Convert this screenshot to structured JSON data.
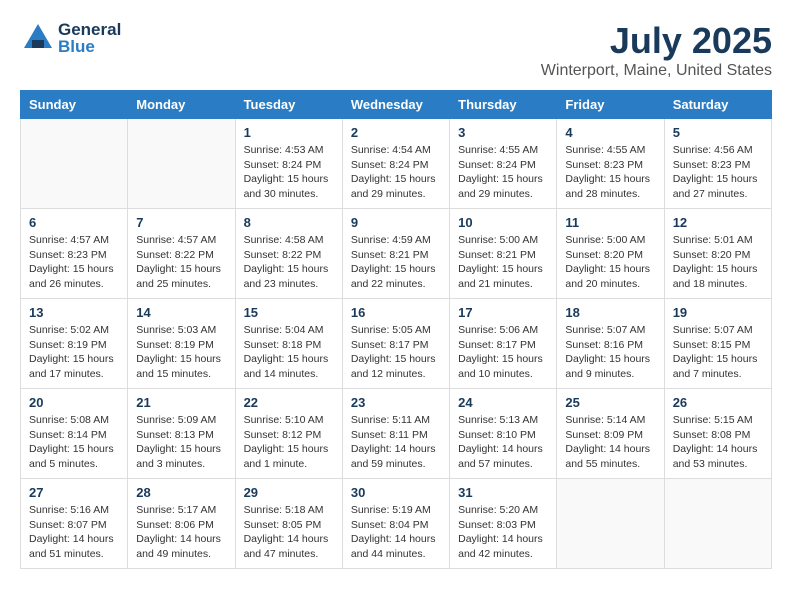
{
  "header": {
    "logo_general": "General",
    "logo_blue": "Blue",
    "month_year": "July 2025",
    "location": "Winterport, Maine, United States"
  },
  "weekdays": [
    "Sunday",
    "Monday",
    "Tuesday",
    "Wednesday",
    "Thursday",
    "Friday",
    "Saturday"
  ],
  "weeks": [
    [
      {
        "day": "",
        "info": ""
      },
      {
        "day": "",
        "info": ""
      },
      {
        "day": "1",
        "info": "Sunrise: 4:53 AM\nSunset: 8:24 PM\nDaylight: 15 hours\nand 30 minutes."
      },
      {
        "day": "2",
        "info": "Sunrise: 4:54 AM\nSunset: 8:24 PM\nDaylight: 15 hours\nand 29 minutes."
      },
      {
        "day": "3",
        "info": "Sunrise: 4:55 AM\nSunset: 8:24 PM\nDaylight: 15 hours\nand 29 minutes."
      },
      {
        "day": "4",
        "info": "Sunrise: 4:55 AM\nSunset: 8:23 PM\nDaylight: 15 hours\nand 28 minutes."
      },
      {
        "day": "5",
        "info": "Sunrise: 4:56 AM\nSunset: 8:23 PM\nDaylight: 15 hours\nand 27 minutes."
      }
    ],
    [
      {
        "day": "6",
        "info": "Sunrise: 4:57 AM\nSunset: 8:23 PM\nDaylight: 15 hours\nand 26 minutes."
      },
      {
        "day": "7",
        "info": "Sunrise: 4:57 AM\nSunset: 8:22 PM\nDaylight: 15 hours\nand 25 minutes."
      },
      {
        "day": "8",
        "info": "Sunrise: 4:58 AM\nSunset: 8:22 PM\nDaylight: 15 hours\nand 23 minutes."
      },
      {
        "day": "9",
        "info": "Sunrise: 4:59 AM\nSunset: 8:21 PM\nDaylight: 15 hours\nand 22 minutes."
      },
      {
        "day": "10",
        "info": "Sunrise: 5:00 AM\nSunset: 8:21 PM\nDaylight: 15 hours\nand 21 minutes."
      },
      {
        "day": "11",
        "info": "Sunrise: 5:00 AM\nSunset: 8:20 PM\nDaylight: 15 hours\nand 20 minutes."
      },
      {
        "day": "12",
        "info": "Sunrise: 5:01 AM\nSunset: 8:20 PM\nDaylight: 15 hours\nand 18 minutes."
      }
    ],
    [
      {
        "day": "13",
        "info": "Sunrise: 5:02 AM\nSunset: 8:19 PM\nDaylight: 15 hours\nand 17 minutes."
      },
      {
        "day": "14",
        "info": "Sunrise: 5:03 AM\nSunset: 8:19 PM\nDaylight: 15 hours\nand 15 minutes."
      },
      {
        "day": "15",
        "info": "Sunrise: 5:04 AM\nSunset: 8:18 PM\nDaylight: 15 hours\nand 14 minutes."
      },
      {
        "day": "16",
        "info": "Sunrise: 5:05 AM\nSunset: 8:17 PM\nDaylight: 15 hours\nand 12 minutes."
      },
      {
        "day": "17",
        "info": "Sunrise: 5:06 AM\nSunset: 8:17 PM\nDaylight: 15 hours\nand 10 minutes."
      },
      {
        "day": "18",
        "info": "Sunrise: 5:07 AM\nSunset: 8:16 PM\nDaylight: 15 hours\nand 9 minutes."
      },
      {
        "day": "19",
        "info": "Sunrise: 5:07 AM\nSunset: 8:15 PM\nDaylight: 15 hours\nand 7 minutes."
      }
    ],
    [
      {
        "day": "20",
        "info": "Sunrise: 5:08 AM\nSunset: 8:14 PM\nDaylight: 15 hours\nand 5 minutes."
      },
      {
        "day": "21",
        "info": "Sunrise: 5:09 AM\nSunset: 8:13 PM\nDaylight: 15 hours\nand 3 minutes."
      },
      {
        "day": "22",
        "info": "Sunrise: 5:10 AM\nSunset: 8:12 PM\nDaylight: 15 hours\nand 1 minute."
      },
      {
        "day": "23",
        "info": "Sunrise: 5:11 AM\nSunset: 8:11 PM\nDaylight: 14 hours\nand 59 minutes."
      },
      {
        "day": "24",
        "info": "Sunrise: 5:13 AM\nSunset: 8:10 PM\nDaylight: 14 hours\nand 57 minutes."
      },
      {
        "day": "25",
        "info": "Sunrise: 5:14 AM\nSunset: 8:09 PM\nDaylight: 14 hours\nand 55 minutes."
      },
      {
        "day": "26",
        "info": "Sunrise: 5:15 AM\nSunset: 8:08 PM\nDaylight: 14 hours\nand 53 minutes."
      }
    ],
    [
      {
        "day": "27",
        "info": "Sunrise: 5:16 AM\nSunset: 8:07 PM\nDaylight: 14 hours\nand 51 minutes."
      },
      {
        "day": "28",
        "info": "Sunrise: 5:17 AM\nSunset: 8:06 PM\nDaylight: 14 hours\nand 49 minutes."
      },
      {
        "day": "29",
        "info": "Sunrise: 5:18 AM\nSunset: 8:05 PM\nDaylight: 14 hours\nand 47 minutes."
      },
      {
        "day": "30",
        "info": "Sunrise: 5:19 AM\nSunset: 8:04 PM\nDaylight: 14 hours\nand 44 minutes."
      },
      {
        "day": "31",
        "info": "Sunrise: 5:20 AM\nSunset: 8:03 PM\nDaylight: 14 hours\nand 42 minutes."
      },
      {
        "day": "",
        "info": ""
      },
      {
        "day": "",
        "info": ""
      }
    ]
  ]
}
